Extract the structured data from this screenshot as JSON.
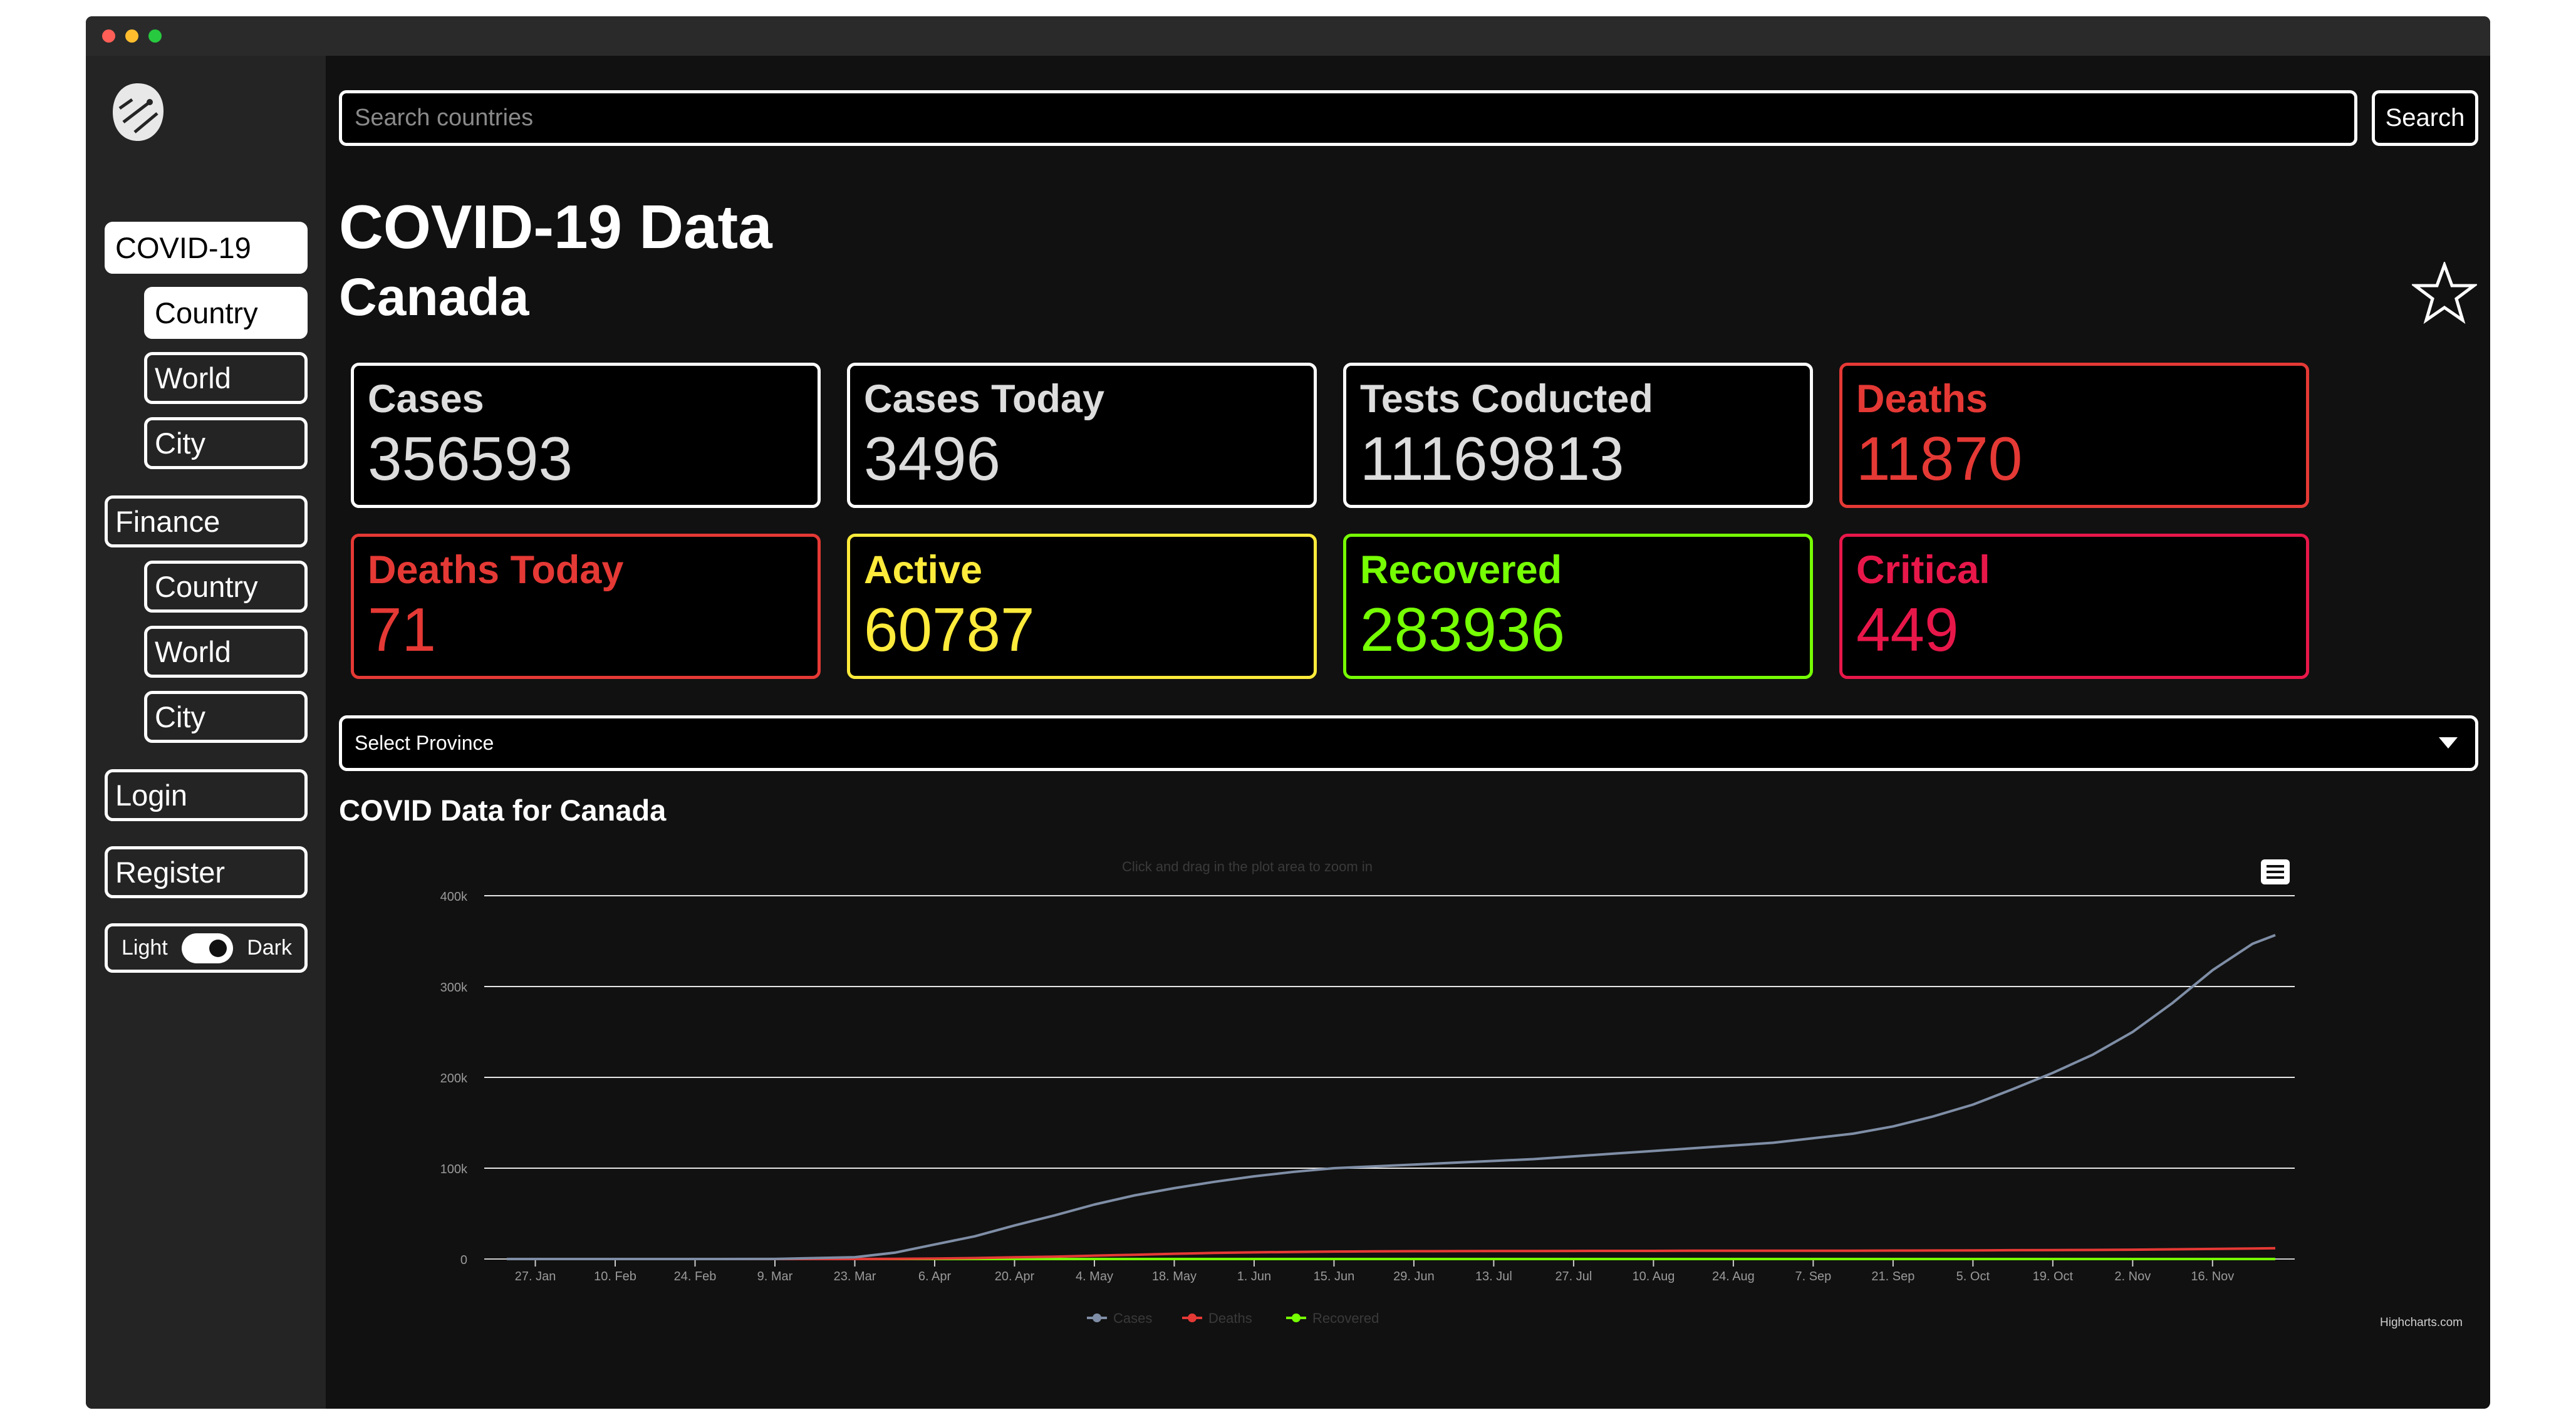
{
  "sidebar": {
    "sections": [
      {
        "label": "COVID-19",
        "sub": [
          "Country",
          "World",
          "City"
        ]
      },
      {
        "label": "Finance",
        "sub": [
          "Country",
          "World",
          "City"
        ]
      }
    ],
    "login": "Login",
    "register": "Register",
    "theme_light": "Light",
    "theme_dark": "Dark",
    "theme_is_dark": true
  },
  "search": {
    "placeholder": "Search countries",
    "button": "Search"
  },
  "header": {
    "title": "COVID-19 Data",
    "country": "Canada"
  },
  "stats": [
    {
      "label": "Cases",
      "value": "356593",
      "color": "#dddddd"
    },
    {
      "label": "Cases Today",
      "value": "3496",
      "color": "#dddddd"
    },
    {
      "label": "Tests Coducted",
      "value": "11169813",
      "color": "#dddddd"
    },
    {
      "label": "Deaths",
      "value": "11870",
      "color": "#e53935"
    },
    {
      "label": "Deaths Today",
      "value": "71",
      "color": "#e53935"
    },
    {
      "label": "Active",
      "value": "60787",
      "color": "#ffeb3b"
    },
    {
      "label": "Recovered",
      "value": "283936",
      "color": "#76ff03"
    },
    {
      "label": "Critical",
      "value": "449",
      "color": "#e8174a"
    }
  ],
  "province_select": {
    "placeholder": "Select Province"
  },
  "chart_title": "COVID Data for Canada",
  "chart_data": {
    "type": "line",
    "subtitle": "Click and drag in the plot area to zoom in",
    "x_tick_labels": [
      "27. Jan",
      "10. Feb",
      "24. Feb",
      "9. Mar",
      "23. Mar",
      "6. Apr",
      "20. Apr",
      "4. May",
      "18. May",
      "1. Jun",
      "15. Jun",
      "29. Jun",
      "13. Jul",
      "27. Jul",
      "10. Aug",
      "24. Aug",
      "7. Sep",
      "21. Sep",
      "5. Oct",
      "19. Oct",
      "2. Nov",
      "16. Nov"
    ],
    "x_dates": [
      "2020-01-22",
      "2020-01-27",
      "2020-02-10",
      "2020-02-24",
      "2020-03-09",
      "2020-03-23",
      "2020-03-30",
      "2020-04-06",
      "2020-04-13",
      "2020-04-20",
      "2020-04-27",
      "2020-05-04",
      "2020-05-11",
      "2020-05-18",
      "2020-05-25",
      "2020-06-01",
      "2020-06-08",
      "2020-06-15",
      "2020-06-22",
      "2020-06-29",
      "2020-07-06",
      "2020-07-13",
      "2020-07-20",
      "2020-07-27",
      "2020-08-03",
      "2020-08-10",
      "2020-08-17",
      "2020-08-24",
      "2020-08-31",
      "2020-09-07",
      "2020-09-14",
      "2020-09-21",
      "2020-09-28",
      "2020-10-05",
      "2020-10-12",
      "2020-10-19",
      "2020-10-26",
      "2020-11-02",
      "2020-11-09",
      "2020-11-16",
      "2020-11-23",
      "2020-11-27"
    ],
    "ylim": [
      0,
      400000
    ],
    "y_tick_labels": [
      "0",
      "100k",
      "200k",
      "300k",
      "400k"
    ],
    "y_ticks": [
      0,
      100000,
      200000,
      300000,
      400000
    ],
    "series": [
      {
        "name": "Cases",
        "color": "#7f8ea6",
        "values": [
          0,
          0,
          0,
          0,
          100,
          2000,
          7000,
          16000,
          25000,
          37000,
          48000,
          60000,
          70000,
          78000,
          85000,
          91000,
          96000,
          100000,
          102000,
          104000,
          106000,
          108000,
          110000,
          113000,
          116000,
          119000,
          122000,
          125000,
          128000,
          133000,
          138000,
          146000,
          157000,
          170000,
          187000,
          205000,
          225000,
          250000,
          282000,
          318000,
          347000,
          356593
        ]
      },
      {
        "name": "Deaths",
        "color": "#e53935",
        "values": [
          0,
          0,
          0,
          0,
          0,
          20,
          150,
          500,
          1000,
          1900,
          2600,
          3700,
          4700,
          5800,
          6700,
          7300,
          7800,
          8200,
          8400,
          8600,
          8700,
          8800,
          8800,
          8900,
          9000,
          9000,
          9100,
          9100,
          9200,
          9200,
          9200,
          9300,
          9400,
          9500,
          9700,
          9800,
          10000,
          10300,
          10700,
          11100,
          11600,
          11870
        ]
      },
      {
        "name": "Recovered",
        "color": "#76ff03",
        "values": [
          0,
          0,
          0,
          0,
          0,
          0,
          0,
          0,
          0,
          0,
          0,
          0,
          0,
          0,
          0,
          0,
          0,
          0,
          0,
          0,
          0,
          0,
          0,
          0,
          0,
          0,
          0,
          0,
          0,
          0,
          0,
          0,
          0,
          0,
          0,
          0,
          0,
          0,
          0,
          0,
          0,
          0
        ]
      }
    ],
    "legend_position": "bottom-center",
    "grid": true,
    "credits": "Highcharts.com"
  }
}
